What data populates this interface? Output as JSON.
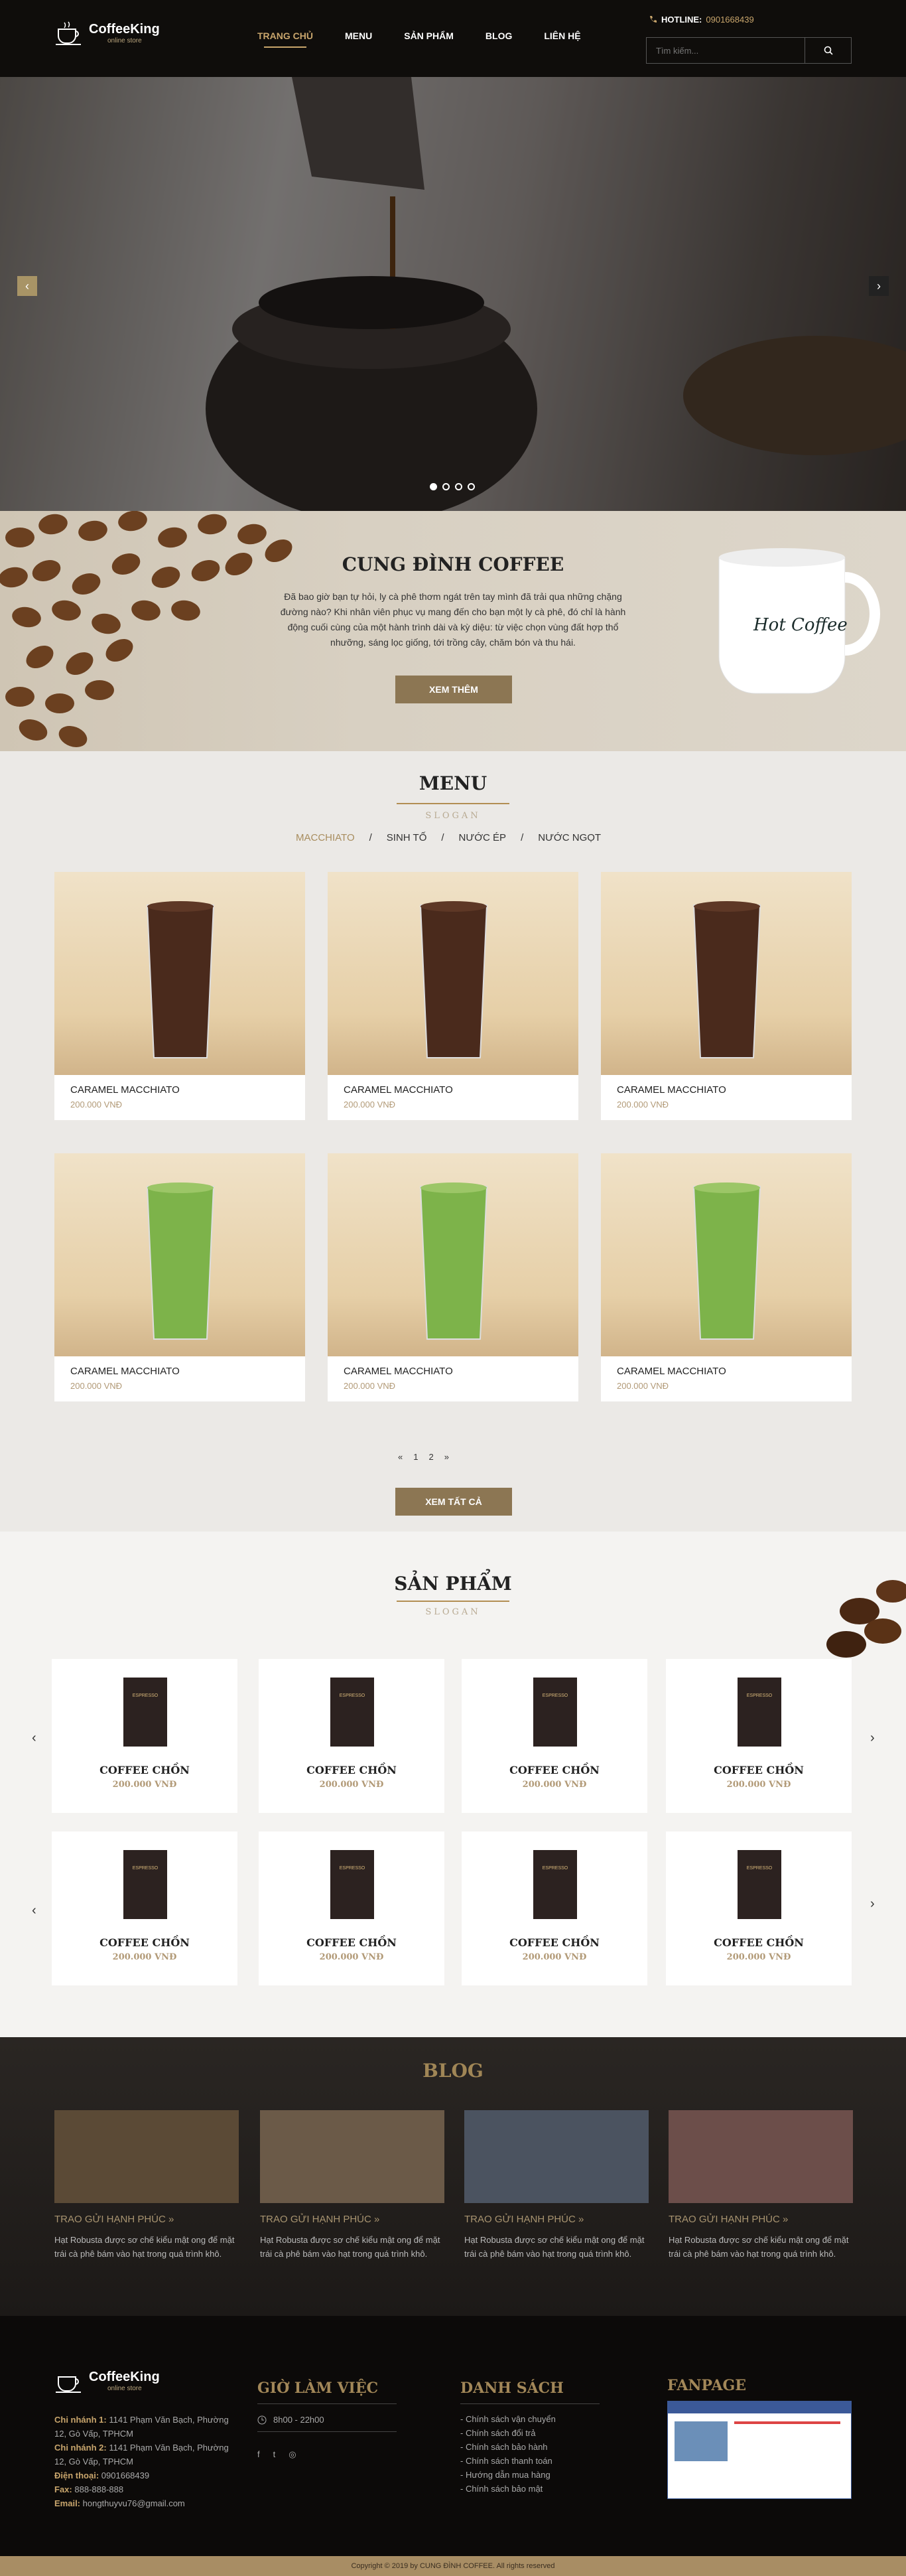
{
  "header": {
    "logo_title": "CoffeeKing",
    "logo_sub": "online store",
    "nav": [
      "TRANG CHỦ",
      "MENU",
      "SẢN PHẨM",
      "BLOG",
      "LIÊN HỆ"
    ],
    "hotline_label": "HOTLINE:",
    "hotline_number": "0901668439",
    "search_placeholder": "Tìm kiếm..."
  },
  "hero": {
    "slides": 4,
    "active_slide": 1
  },
  "about": {
    "title": "CUNG ĐÌNH COFFEE",
    "text": "Đã bao giờ bạn tự hỏi, ly cà phê thơm ngát trên tay mình đã trải qua những chặng đường nào? Khi nhân viên phục vụ mang đến cho bạn một ly cà phê, đó chỉ là hành động cuối cùng của một hành trình dài và kỳ diệu: từ việc chọn vùng đất hợp thổ nhưỡng, sáng lọc giống, tới trồng cây, chăm bón và thu hái.",
    "button": "XEM THÊM",
    "mug_text": "Hot Coffee"
  },
  "menu": {
    "title": "MENU",
    "slogan": "SLOGAN",
    "tabs": [
      "MACCHIATO",
      "SINH TỐ",
      "NƯỚC ÉP",
      "NƯỚC NGỌT"
    ],
    "items": [
      {
        "name": "CARAMEL MACCHIATO",
        "price": "200.000 VNĐ"
      },
      {
        "name": "CARAMEL MACCHIATO",
        "price": "200.000 VNĐ"
      },
      {
        "name": "CARAMEL MACCHIATO",
        "price": "200.000 VNĐ"
      },
      {
        "name": "CARAMEL MACCHIATO",
        "price": "200.000 VNĐ"
      },
      {
        "name": "CARAMEL MACCHIATO",
        "price": "200.000 VNĐ"
      },
      {
        "name": "CARAMEL MACCHIATO",
        "price": "200.000 VNĐ"
      }
    ],
    "pager": [
      "«",
      "1",
      "2",
      "»"
    ],
    "button": "XEM TẤT CẢ"
  },
  "products": {
    "title": "SẢN PHẨM",
    "slogan": "SLOGAN",
    "pkg_label": "ESPRESSO",
    "items": [
      {
        "name": "COFFEE CHỒN",
        "price": "200.000 VNĐ"
      },
      {
        "name": "COFFEE CHỒN",
        "price": "200.000 VNĐ"
      },
      {
        "name": "COFFEE CHỒN",
        "price": "200.000 VNĐ"
      },
      {
        "name": "COFFEE CHỒN",
        "price": "200.000 VNĐ"
      },
      {
        "name": "COFFEE CHỒN",
        "price": "200.000 VNĐ"
      },
      {
        "name": "COFFEE CHỒN",
        "price": "200.000 VNĐ"
      },
      {
        "name": "COFFEE CHỒN",
        "price": "200.000 VNĐ"
      },
      {
        "name": "COFFEE CHỒN",
        "price": "200.000 VNĐ"
      }
    ]
  },
  "blog": {
    "title": "BLOG",
    "posts": [
      {
        "title": "TRAO GỬI HẠNH PHÚC",
        "text": "Hạt Robusta được sơ chế kiểu mật ong để mặt trái cà phê bám vào hạt trong quá trình khô.",
        "color": "#5b4a36"
      },
      {
        "title": "TRAO GỬI HẠNH PHÚC",
        "text": "Hạt Robusta được sơ chế kiểu mật ong để mặt trái cà phê bám vào hạt trong quá trình khô.",
        "color": "#6b5a48"
      },
      {
        "title": "TRAO GỬI HẠNH PHÚC",
        "text": "Hạt Robusta được sơ chế kiểu mật ong để mặt trái cà phê bám vào hạt trong quá trình khô.",
        "color": "#4b5360"
      },
      {
        "title": "TRAO GỬI HẠNH PHÚC",
        "text": "Hạt Robusta được sơ chế kiểu mật ong để mặt trái cà phê bám vào hạt trong quá trình khô.",
        "color": "#6c4e4a"
      }
    ]
  },
  "footer": {
    "logo_title": "CoffeeKing",
    "logo_sub": "online store",
    "branch1_label": "Chi nhánh 1:",
    "branch1": "1141 Phạm Văn Bạch, Phường 12, Gò Vấp, TPHCM",
    "branch2_label": "Chi nhánh 2:",
    "branch2": "1141 Phạm Văn Bạch, Phường 12, Gò Vấp, TPHCM",
    "phone_label": "Điện thoại:",
    "phone": "0901668439",
    "fax_label": "Fax:",
    "fax": "888-888-888",
    "email_label": "Email:",
    "email": "hongthuyvu76@gmail.com",
    "hours_title": "GIỜ LÀM VIỆC",
    "hours": "8h00 - 22h00",
    "policy_title": "DANH SÁCH",
    "policies": [
      "- Chính sách vận chuyển",
      "- Chính sách đổi trả",
      "- Chính sách bảo hành",
      "- Chính sách thanh toán",
      "- Hướng dẫn mua hàng",
      "- Chính sách bảo mật"
    ],
    "fanpage_title": "FANPAGE",
    "copyright": "Copyright © 2019 by CUNG ĐÌNH COFFEE. All rights reserved"
  },
  "colors": {
    "accent": "#c8a56c",
    "button": "#8c7653",
    "header_bg": "#0f0d0b"
  }
}
